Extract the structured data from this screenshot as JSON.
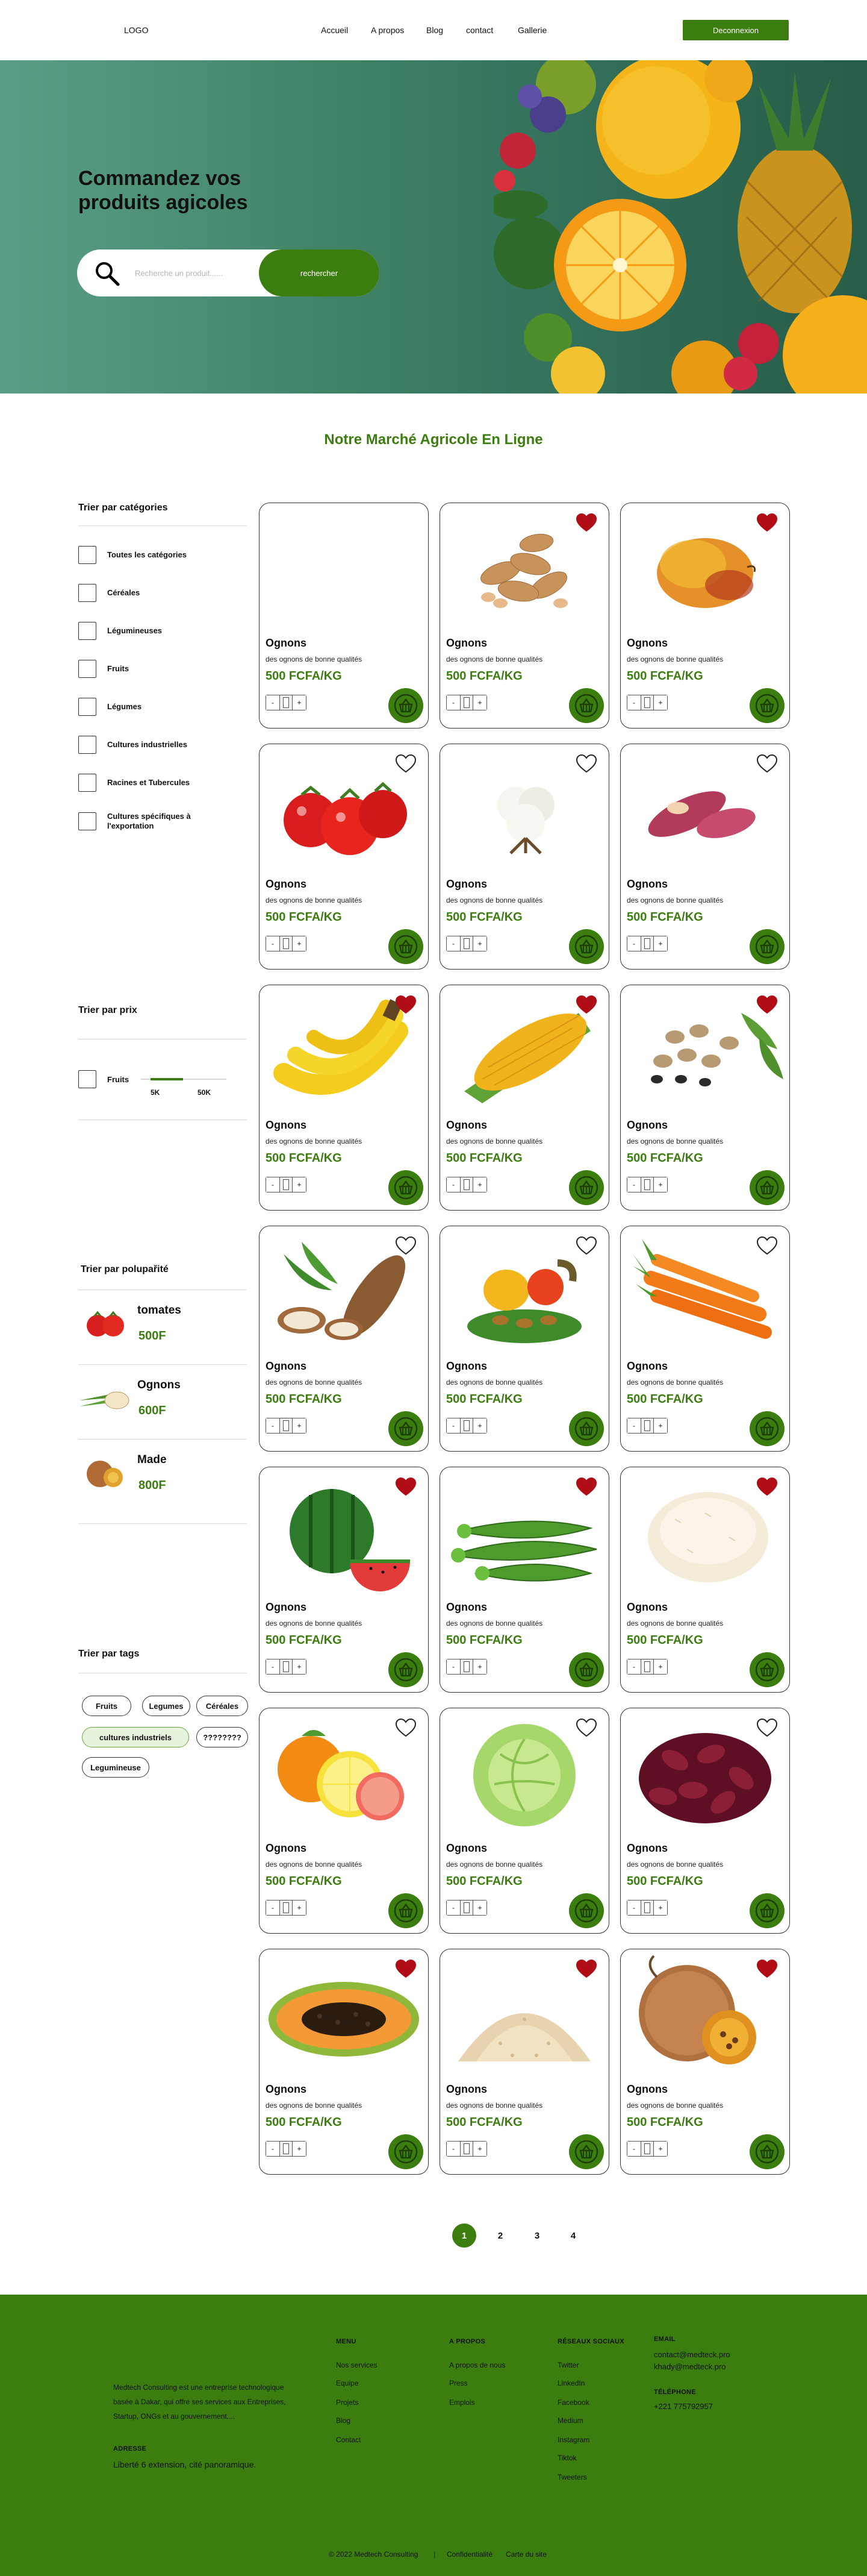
{
  "header": {
    "logo": "LOGO",
    "nav": [
      "Accueil",
      "A propos",
      "Blog",
      "contact",
      "Gallerie"
    ],
    "logout_label": "Deconnexion"
  },
  "hero": {
    "title": "Commandez vos produits agicoles",
    "search_placeholder": "Recherche un produit......",
    "search_button": "rechercher"
  },
  "section_title": "Notre Marché Agricole En Ligne",
  "sidebar": {
    "categories_heading": "Trier par catégories",
    "categories": [
      "Toutes les catégories",
      "Céréales",
      "Légumineuses",
      "Fruits",
      "Légumes",
      "Cultures industrielles",
      "Racines et Tubercules",
      "Cultures spécifiques à l'exportation"
    ],
    "price_heading": "Trier par prix",
    "price_filter": {
      "label": "Fruits",
      "min": "5K",
      "max": "50K"
    },
    "popular_heading": "Trier par  polupařité",
    "popular": [
      {
        "name": "tomates",
        "price": "500F"
      },
      {
        "name": "Ognons",
        "price": "600F"
      },
      {
        "name": "Made",
        "price": "800F"
      }
    ],
    "tags_heading": "Trier par  tags",
    "tags": [
      "Fruits",
      "Legumes",
      "Céréales",
      "cultures  industriels",
      "????????",
      "Legumineuse"
    ]
  },
  "products": [
    {
      "image": "empty",
      "favorite": false,
      "show_heart": false
    },
    {
      "image": "peanuts-image",
      "favorite": true,
      "show_heart": true
    },
    {
      "image": "mango-image",
      "favorite": true,
      "show_heart": true
    },
    {
      "image": "tomatoes-image",
      "favorite": false,
      "show_heart": true
    },
    {
      "image": "cotton-image",
      "favorite": false,
      "show_heart": true
    },
    {
      "image": "sweet-potato-image",
      "favorite": false,
      "show_heart": true
    },
    {
      "image": "bananas-image",
      "favorite": true,
      "show_heart": true
    },
    {
      "image": "corn-image",
      "favorite": true,
      "show_heart": true
    },
    {
      "image": "beans-image",
      "favorite": true,
      "show_heart": true
    },
    {
      "image": "cassava-image",
      "favorite": false,
      "show_heart": true
    },
    {
      "image": "cashew-image",
      "favorite": false,
      "show_heart": true
    },
    {
      "image": "carrots-image",
      "favorite": false,
      "show_heart": true
    },
    {
      "image": "watermelon-image",
      "favorite": true,
      "show_heart": true
    },
    {
      "image": "okra-image",
      "favorite": true,
      "show_heart": true
    },
    {
      "image": "rice-image",
      "favorite": true,
      "show_heart": true
    },
    {
      "image": "citrus-image",
      "favorite": false,
      "show_heart": true
    },
    {
      "image": "cabbage-image",
      "favorite": false,
      "show_heart": true
    },
    {
      "image": "hibiscus-image",
      "favorite": false,
      "show_heart": true
    },
    {
      "image": "papaya-image",
      "favorite": true,
      "show_heart": true
    },
    {
      "image": "sesame-image",
      "favorite": true,
      "show_heart": true
    },
    {
      "image": "madd-fruit-image",
      "favorite": true,
      "show_heart": true
    }
  ],
  "product_card": {
    "name": "Ognons",
    "description": "des ognons de bonne qualités",
    "price": "500 FCFA/KG",
    "minus": "-",
    "plus": "+"
  },
  "pagination": [
    "1",
    "2",
    "3",
    "4"
  ],
  "footer": {
    "description": "Medtech Consulting est une entreprise technologique basée à Dakar, qui offre ses services aux Entreprises, Startup, ONGs et au gouvernement....",
    "address_heading": "ADRESSE",
    "address": "Liberté 6 extension, cité panoramique.",
    "menu_heading": "MENU",
    "menu": [
      "Nos services",
      "Equipe",
      "Projets",
      "Blog",
      "Contact"
    ],
    "about_heading": "A PROPOS",
    "about": [
      "A propos de nous",
      "Press",
      "Emplois"
    ],
    "social_heading": "RÉSEAUX SOCIAUX",
    "social": [
      "Twitter",
      "LinkedIn",
      "Facebook",
      "Medium",
      "Instagram",
      "Tiktok",
      "Tweeters"
    ],
    "email_heading": "EMAIL",
    "emails": [
      "contact@medteck.pro",
      "khady@medteck.pro"
    ],
    "phone_heading": "TÉLÉPHONE",
    "phone": "+221 775792957",
    "copyright": "© 2022 Medtech Consulting",
    "separator": "|",
    "privacy": "Confidentialité",
    "sitemap": "Carte du site"
  },
  "colors": {
    "brand_green": "#3b7d0e",
    "heart_red": "#b00d16",
    "footer_bg": "#3b7d0e"
  }
}
